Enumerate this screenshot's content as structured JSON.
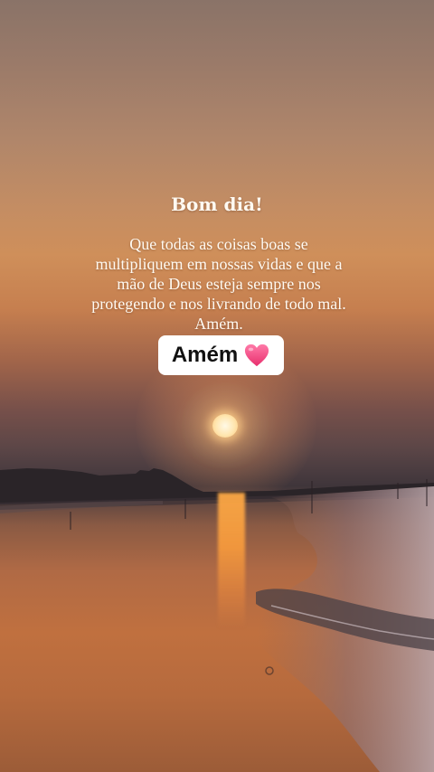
{
  "post": {
    "title": "Bom dia!",
    "message": "Que todas as coisas boas se multipliquem em nossas vidas e que a mão de Deus esteja sempre nos protegendo e nos livrando de todo mal. Amém.",
    "sticker_text": "Amém",
    "sticker_icon": "pink-heart-icon"
  },
  "colors": {
    "text": "#fffaf2",
    "sticker_bg": "#ffffff",
    "heart": "#f0457e"
  }
}
